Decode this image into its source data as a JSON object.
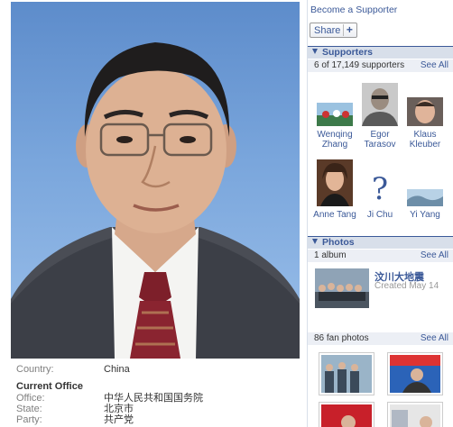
{
  "info": {
    "country_label": "Country:",
    "country_value": "China",
    "current_office_heading": "Current Office",
    "office_label": "Office:",
    "office_value": "中华人民共和国国务院",
    "state_label": "State:",
    "state_value": "北京市",
    "party_label": "Party:",
    "party_value": "共产党"
  },
  "sidebar": {
    "become_supporter": "Become a Supporter",
    "share_label": "Share",
    "share_plus": "+",
    "supporters": {
      "heading": "Supporters",
      "count_text": "6 of 17,149 supporters",
      "see_all": "See All",
      "items": [
        {
          "first": "Wenqing",
          "last": "Zhang"
        },
        {
          "first": "Egor",
          "last": "Tarasov"
        },
        {
          "first": "Klaus",
          "last": "Kleuber"
        },
        {
          "first": "Anne Tang",
          "last": ""
        },
        {
          "first": "Ji Chu",
          "last": ""
        },
        {
          "first": "Yi Yang",
          "last": ""
        }
      ]
    },
    "photos": {
      "heading": "Photos",
      "album_count": "1 album",
      "see_all": "See All",
      "album_title": "汶川大地震",
      "album_date": "Created May 14",
      "fan_photos_count": "86 fan photos",
      "fan_see_all": "See All"
    }
  }
}
